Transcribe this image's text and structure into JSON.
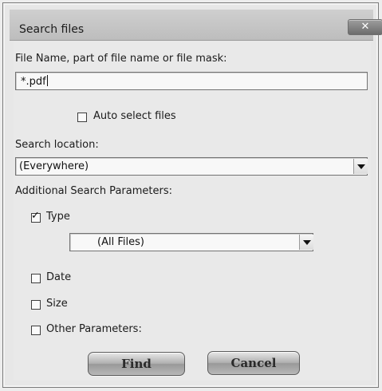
{
  "dialog": {
    "title": "Search files",
    "close_glyph": "✕"
  },
  "filename": {
    "label": "File Name, part of file name or file mask:",
    "value": "*.pdf"
  },
  "auto_select": {
    "label": "Auto select files",
    "checked": false
  },
  "location": {
    "label": "Search location:",
    "value": "(Everywhere)"
  },
  "additional": {
    "label": "Additional Search Parameters:"
  },
  "type": {
    "label": "Type",
    "checked": true,
    "check_glyph": "✓",
    "value": "(All Files)"
  },
  "date": {
    "label": "Date",
    "checked": false
  },
  "size": {
    "label": "Size",
    "checked": false
  },
  "other": {
    "label": "Other Parameters:",
    "checked": false
  },
  "buttons": {
    "find": "Find",
    "cancel": "Cancel"
  }
}
